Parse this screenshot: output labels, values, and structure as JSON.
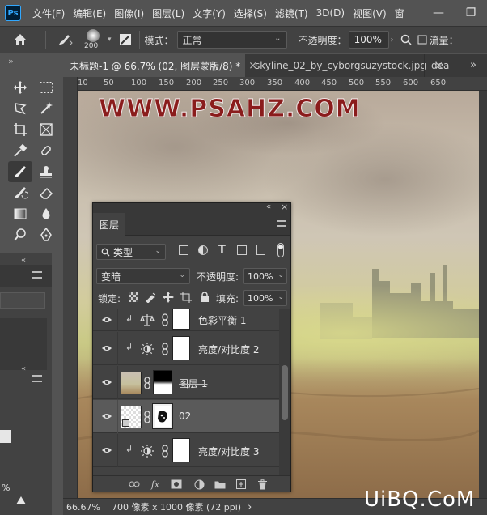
{
  "app": {
    "logo_text": "Ps"
  },
  "menubar": {
    "items": [
      "文件(F)",
      "编辑(E)",
      "图像(I)",
      "图层(L)",
      "文字(Y)",
      "选择(S)",
      "滤镜(T)",
      "3D(D)",
      "视图(V)",
      "窗"
    ],
    "minimize": "—",
    "restore": "❐"
  },
  "options": {
    "brush_size": "200",
    "mode_label": "模式：",
    "mode_value": "正常",
    "opacity_label": "不透明度：",
    "opacity_value": "100%",
    "flow_label": "流量："
  },
  "tabs": [
    {
      "label": "未标题-1 @ 66.7% (02, 图层蒙版/8) *",
      "close": "×",
      "active": true
    },
    {
      "label": "skyline_02_by_cyborgsuzystock.jpg",
      "close": "×",
      "active": false
    },
    {
      "label": "dea",
      "close": "",
      "active": false
    }
  ],
  "tab_overflow": "»",
  "ruler": {
    "h_labels": [
      "10",
      "50",
      "100",
      "150",
      "200",
      "250",
      "300",
      "350",
      "400",
      "450",
      "500",
      "550",
      "600",
      "650"
    ]
  },
  "canvas": {
    "watermark": "WWW.PSAHZ.COM"
  },
  "statusbar": {
    "zoom": "66.67%",
    "doc_info": "700 像素 x 1000 像素 (72 ppi)",
    "more": "›"
  },
  "layers_panel": {
    "collapse": "«",
    "close": "×",
    "tab_label": "图层",
    "filter_label": "类型",
    "blend_mode": "变暗",
    "opacity_label": "不透明度:",
    "opacity_value": "100%",
    "lock_label": "锁定:",
    "fill_label": "填充:",
    "fill_value": "100%",
    "layers": [
      {
        "name": "色彩平衡 1",
        "type": "color-balance",
        "clipped": true,
        "selected": false
      },
      {
        "name": "亮度/对比度 2",
        "type": "brightness-contrast",
        "clipped": true,
        "selected": false
      },
      {
        "name": "图层 1",
        "type": "image",
        "clipped": false,
        "selected": false
      },
      {
        "name": "02",
        "type": "smart-object",
        "clipped": false,
        "selected": true
      },
      {
        "name": "亮度/对比度 3",
        "type": "brightness-contrast",
        "clipped": true,
        "selected": false
      }
    ],
    "bottom_fx": "fx"
  },
  "left_panel": {
    "collapse": "«",
    "percent_label": "%"
  },
  "site_logo": "UiBQ.CoM",
  "colors": {
    "accent": "#31a8ff",
    "watermark": "#8a1c1c",
    "panel": "#424242",
    "app_bg": "#535353"
  }
}
